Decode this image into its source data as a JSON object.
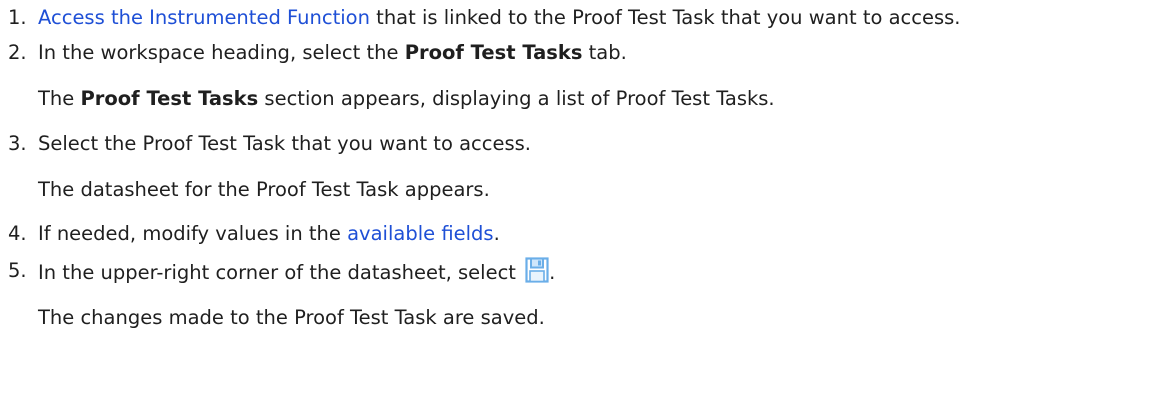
{
  "steps": [
    {
      "number": "1.",
      "link": "Access the Instrumented Function",
      "text_after_link": " that is linked to the Proof Test Task that you want to access."
    },
    {
      "number": "2.",
      "text_before": "In the workspace heading, select the ",
      "bold": "Proof Test Tasks",
      "text_after": " tab.",
      "result_bold": "Proof Test Tasks",
      "result_text": " section appears, displaying a list of Proof Test Tasks.",
      "result_prefix": "The "
    },
    {
      "number": "3.",
      "text": "Select the Proof Test Task that you want to access.",
      "result": "The datasheet for the Proof Test Task appears."
    },
    {
      "number": "4.",
      "text_before": "If needed, modify values in the ",
      "link": "available fields",
      "text_after": "."
    },
    {
      "number": "5.",
      "text_before": "In the upper-right corner of the datasheet, select ",
      "icon": "save-icon",
      "text_after": ".",
      "result": "The changes made to the Proof Test Task are saved."
    }
  ],
  "colors": {
    "link": "#1e4fd6",
    "text": "#1f1f1f",
    "icon": "#6aaee8"
  }
}
